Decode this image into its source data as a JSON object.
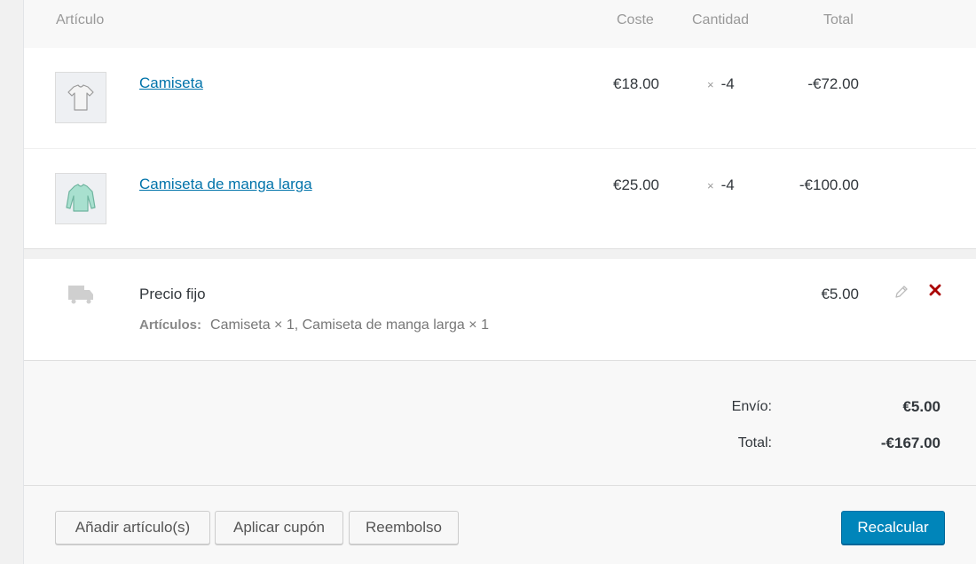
{
  "table": {
    "headers": {
      "item": "Artículo",
      "cost": "Coste",
      "qty": "Cantidad",
      "total": "Total"
    },
    "items": [
      {
        "name": "Camiseta",
        "cost": "€18.00",
        "qty_symbol": "×",
        "qty": "-4",
        "total": "-€72.00",
        "icon": "tshirt-icon"
      },
      {
        "name": "Camiseta de manga larga",
        "cost": "€25.00",
        "qty_symbol": "×",
        "qty": "-4",
        "total": "-€100.00",
        "icon": "long-sleeve-shirt-icon"
      }
    ]
  },
  "shipping": {
    "name": "Precio fijo",
    "meta_label": "Artículos:",
    "meta_value": "Camiseta × 1, Camiseta de manga larga × 1",
    "total": "€5.00",
    "icon": "truck-icon"
  },
  "totals": {
    "shipping_label": "Envío:",
    "shipping_value": "€5.00",
    "total_label": "Total:",
    "total_value": "-€167.00"
  },
  "actions": {
    "add_items": "Añadir artículo(s)",
    "apply_coupon": "Aplicar cupón",
    "refund": "Reembolso",
    "recalculate": "Recalcular"
  },
  "colors": {
    "link": "#0073aa",
    "primary_button": "#0085ba",
    "delete": "#a00"
  }
}
